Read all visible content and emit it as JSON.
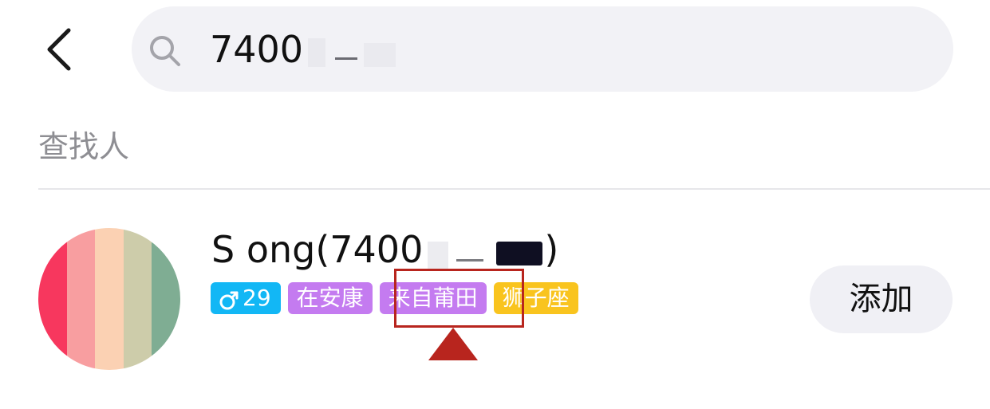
{
  "header": {
    "back_icon": "chevron-left-icon"
  },
  "search": {
    "icon": "search-icon",
    "query_visible": "7400"
  },
  "section": {
    "title": "查找人"
  },
  "result": {
    "avatar_colors": [
      "#f7375e",
      "#f89ea0",
      "#fbd1b3",
      "#cdccaa",
      "#7fad93"
    ],
    "name_prefix": "S ong(7400",
    "name_suffix": ")",
    "tags": {
      "gender_icon": "male-icon",
      "age": "29",
      "location": "在安康",
      "hometown": "来自莆田",
      "zodiac": "狮子座"
    },
    "tag_colors": {
      "gender": "#12b7f5",
      "location": "#c47bf0",
      "hometown": "#c47bf0",
      "zodiac": "#f9c41e"
    },
    "add_label": "添加"
  },
  "annotation": {
    "color": "#b8251e"
  }
}
